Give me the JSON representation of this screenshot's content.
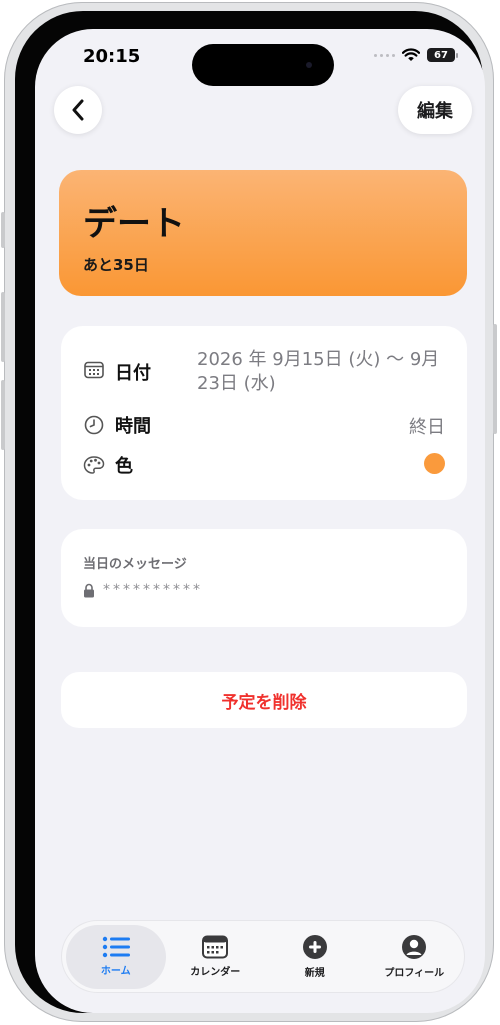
{
  "status_bar": {
    "time": "20:15",
    "battery": "67"
  },
  "nav": {
    "edit_label": "編集"
  },
  "event": {
    "title": "デート",
    "countdown": "あと35日",
    "color": "#fa9a3c"
  },
  "details": {
    "date": {
      "label": "日付",
      "value": "2026 年 9月15日 (火) 〜 9月23日 (水)"
    },
    "time": {
      "label": "時間",
      "value": "終日"
    },
    "color": {
      "label": "色"
    }
  },
  "message": {
    "label": "当日のメッセージ",
    "masked": "**********"
  },
  "delete_label": "予定を削除",
  "tabs": [
    {
      "label": "ホーム",
      "icon": "list-icon",
      "active": true
    },
    {
      "label": "カレンダー",
      "icon": "calendar-icon",
      "active": false
    },
    {
      "label": "新規",
      "icon": "plus-circle-icon",
      "active": false
    },
    {
      "label": "プロフィール",
      "icon": "person-circle-icon",
      "active": false
    }
  ],
  "colors": {
    "accent": "#1d7cf2",
    "destructive": "#f0312d",
    "hero_top": "#fbb474",
    "hero_bottom": "#fa9734"
  }
}
